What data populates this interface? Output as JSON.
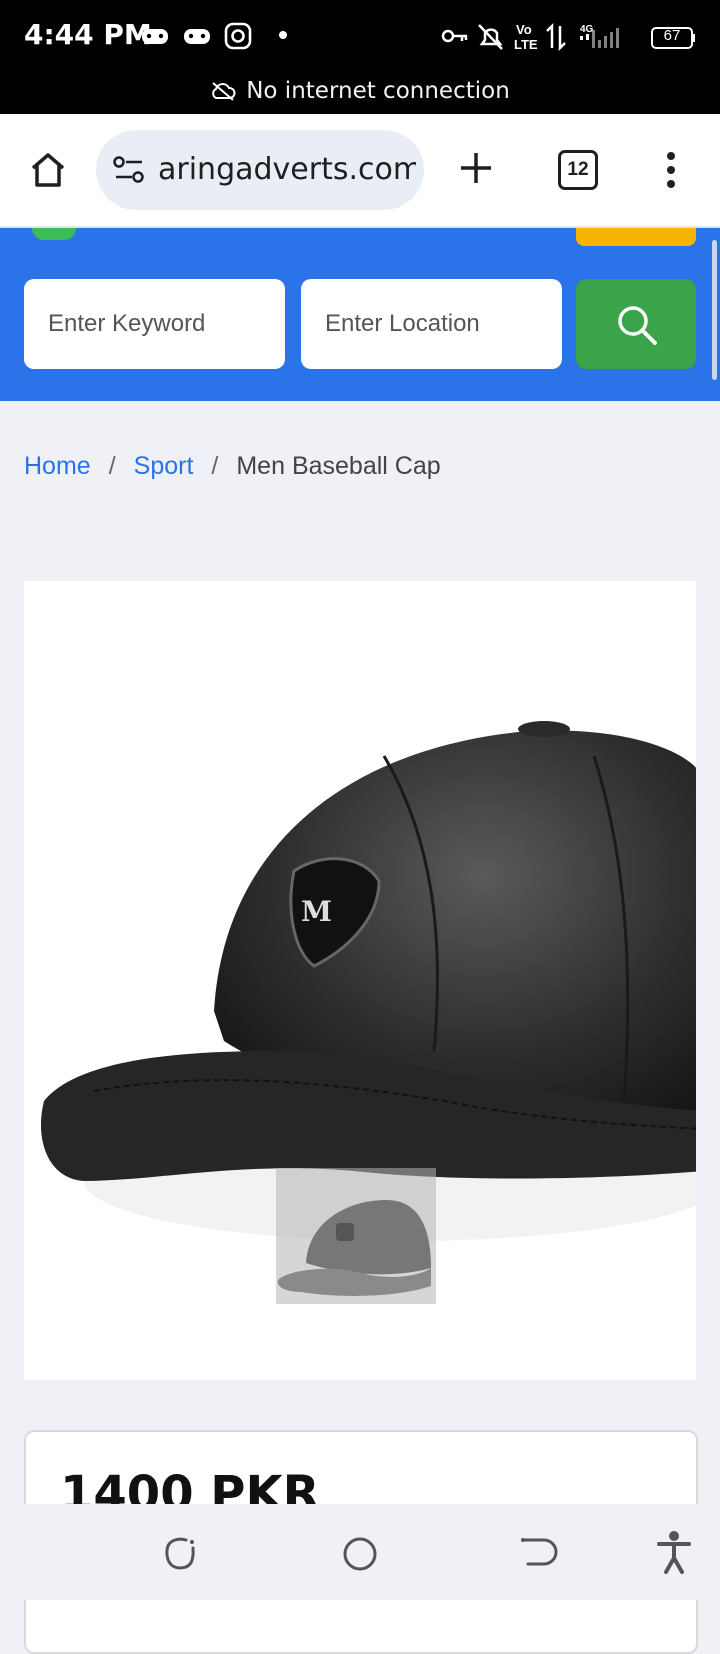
{
  "status_bar": {
    "time": "4:44 PM",
    "network": "Vo LTE",
    "signal": "4G",
    "battery": "67",
    "banner": "No internet connection"
  },
  "browser": {
    "url": "aringadverts.com",
    "tab_count": "12"
  },
  "search": {
    "keyword_placeholder": "Enter Keyword",
    "location_placeholder": "Enter Location"
  },
  "breadcrumb": {
    "home": "Home",
    "category": "Sport",
    "current": "Men Baseball Cap",
    "separator": "/"
  },
  "product": {
    "price": "1400 PKR"
  },
  "colors": {
    "accent_blue": "#2a73e8",
    "search_green": "#3aa44a",
    "highlight_yellow": "#f5b400"
  }
}
